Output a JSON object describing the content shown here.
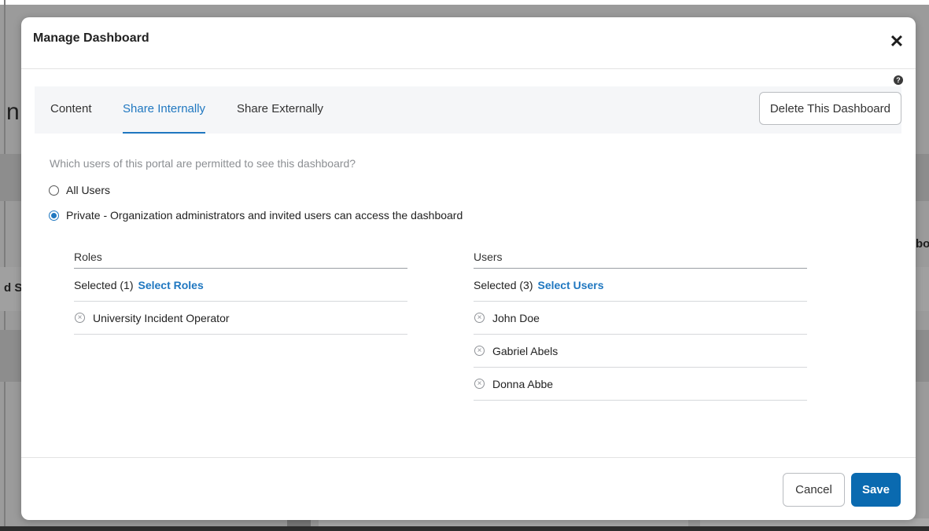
{
  "modal": {
    "title": "Manage Dashboard",
    "close_symbol": "✕",
    "help_symbol": "?"
  },
  "tabs": [
    {
      "label": "Content",
      "active": false
    },
    {
      "label": "Share Internally",
      "active": true
    },
    {
      "label": "Share Externally",
      "active": false
    }
  ],
  "delete_label": "Delete This Dashboard",
  "question": "Which users of this portal are permitted to see this dashboard?",
  "options": [
    {
      "label": "All Users",
      "selected": false
    },
    {
      "label": "Private - Organization administrators and invited users can access the dashboard",
      "selected": true
    }
  ],
  "roles": {
    "header": "Roles",
    "selected_text": "Selected (1)",
    "select_link": "Select Roles",
    "items": [
      "University Incident Operator"
    ]
  },
  "users": {
    "header": "Users",
    "selected_text": "Selected (3)",
    "select_link": "Select Users",
    "items": [
      "John Doe",
      "Gabriel Abels",
      "Donna Abbe"
    ]
  },
  "remove_symbol": "×",
  "footer": {
    "cancel_label": "Cancel",
    "save_label": "Save"
  },
  "colors": {
    "accent": "#1f77c0",
    "primary_button": "#0a6ab0"
  },
  "background": {
    "fragment_bo": "bo",
    "fragment_d_s": "d S",
    "fragment_n": "n"
  }
}
